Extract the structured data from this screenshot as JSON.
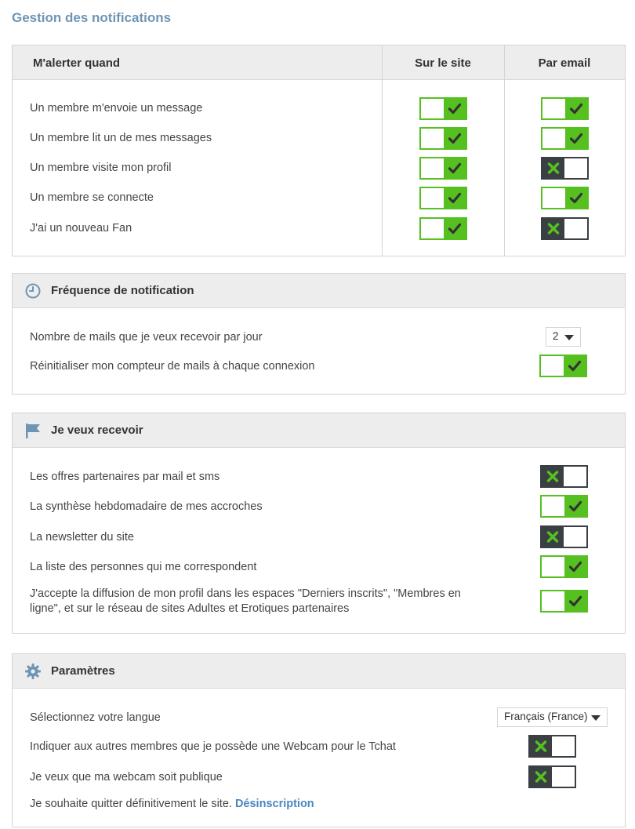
{
  "page_title": "Gestion des notifications",
  "alerts": {
    "headers": {
      "event": "M'alerter quand",
      "site": "Sur le site",
      "email": "Par email"
    },
    "rows": [
      {
        "label": "Un membre m'envoie un message",
        "site": true,
        "email": true
      },
      {
        "label": "Un membre lit un de mes messages",
        "site": true,
        "email": true
      },
      {
        "label": "Un membre visite mon profil",
        "site": true,
        "email": false
      },
      {
        "label": "Un membre se connecte",
        "site": true,
        "email": true
      },
      {
        "label": "J'ai un nouveau Fan",
        "site": true,
        "email": false
      }
    ]
  },
  "frequency": {
    "title": "Fréquence de notification",
    "icon": "clock-icon",
    "mails_per_day_label": "Nombre de mails que je veux recevoir par jour",
    "mails_per_day_value": "2",
    "reset_counter_label": "Réinitialiser mon compteur de mails à chaque connexion",
    "reset_counter": true
  },
  "receive": {
    "title": "Je veux recevoir",
    "icon": "flag-icon",
    "items": [
      {
        "label": "Les offres partenaires par mail et sms",
        "on": false
      },
      {
        "label": "La synthèse hebdomadaire de mes accroches",
        "on": true
      },
      {
        "label": "La newsletter du site",
        "on": false
      },
      {
        "label": "La liste des personnes qui me correspondent",
        "on": true
      },
      {
        "label_line1": "J'accepte la diffusion de mon profil dans les espaces \"Derniers inscrits\", \"Membres en",
        "label_line2": "ligne\", et sur le réseau de sites Adultes et Erotiques partenaires",
        "on": true
      }
    ]
  },
  "settings": {
    "title": "Paramètres",
    "icon": "gear-icon",
    "language_label": "Sélectionnez votre langue",
    "language_value": "Français (France)",
    "webcam_label": "Indiquer aux autres membres que je possède une Webcam pour le Tchat",
    "webcam": false,
    "webcam_public_label": "Je veux que ma webcam soit publique",
    "webcam_public": false,
    "quit_text": "Je souhaite quitter définitivement le site.",
    "unsubscribe_label": "Désinscription"
  },
  "colors": {
    "accent_green": "#55c01f",
    "off_dark": "#3a3f43",
    "title_blue": "#6f95b4",
    "link_blue": "#4a86c0"
  }
}
